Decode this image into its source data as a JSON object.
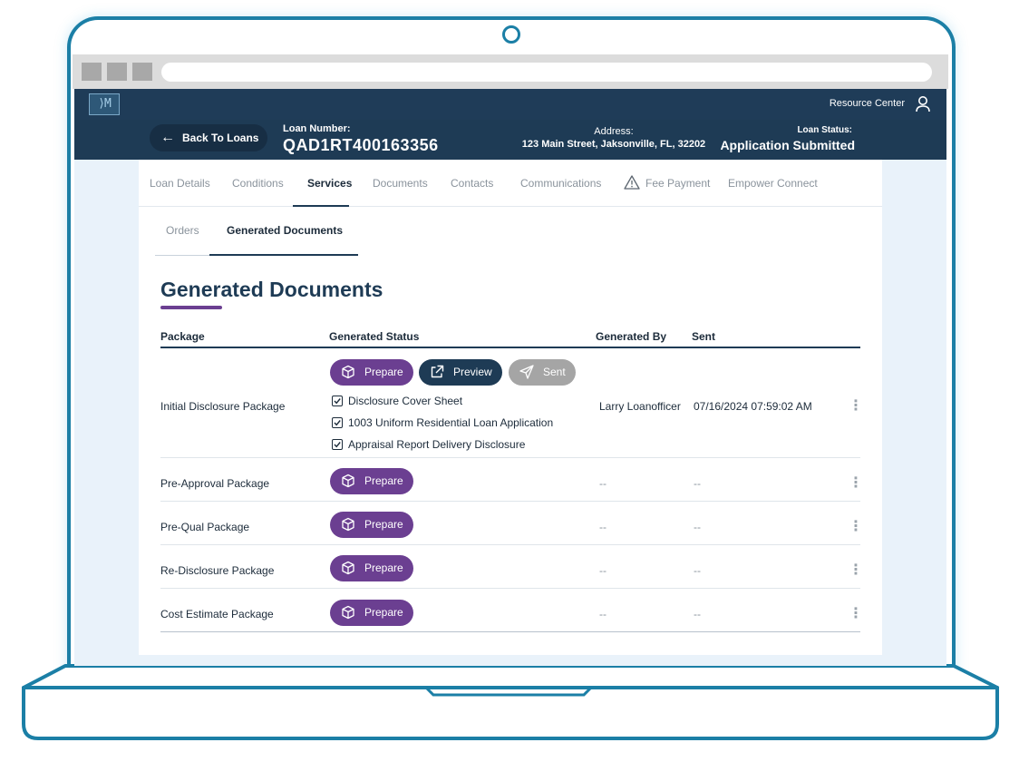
{
  "app": {
    "logo_text": "⟩M",
    "resource_center": "Resource Center"
  },
  "loan_header": {
    "back_label": "Back To Loans",
    "loan_number_label": "Loan Number:",
    "loan_number": "QAD1RT400163356",
    "address_label": "Address:",
    "address": "123 Main Street, Jaksonville, FL, 32202",
    "status_label": "Loan Status:",
    "status": "Application Submitted"
  },
  "tabs": [
    {
      "label": "Loan Details",
      "active": false
    },
    {
      "label": "Conditions",
      "active": false
    },
    {
      "label": "Services",
      "active": true
    },
    {
      "label": "Documents",
      "active": false
    },
    {
      "label": "Contacts",
      "active": false
    },
    {
      "label": "Communications",
      "active": false
    },
    {
      "label": "Fee Payment",
      "active": false,
      "icon": "warning-icon"
    },
    {
      "label": "Empower Connect",
      "active": false
    }
  ],
  "subtabs": [
    {
      "label": "Orders",
      "active": false
    },
    {
      "label": "Generated Documents",
      "active": true
    }
  ],
  "section": {
    "title": "Generated Documents"
  },
  "table": {
    "headers": [
      "Package",
      "Generated Status",
      "Generated By",
      "Sent"
    ],
    "actions": {
      "prepare": "Prepare",
      "preview": "Preview",
      "sent": "Sent"
    },
    "rows": [
      {
        "package": "Initial Disclosure Package",
        "documents": [
          "Disclosure Cover Sheet",
          "1003 Uniform Residential Loan Application",
          "Appraisal Report Delivery Disclosure"
        ],
        "generated_by": "Larry Loanofficer",
        "sent": "07/16/2024 07:59:02 AM"
      },
      {
        "package": "Pre-Approval Package",
        "generated_by": "--",
        "sent": "--"
      },
      {
        "package": "Pre-Qual Package",
        "generated_by": "--",
        "sent": "--"
      },
      {
        "package": "Re-Disclosure Package",
        "generated_by": "--",
        "sent": "--"
      },
      {
        "package": "Cost Estimate Package",
        "generated_by": "--",
        "sent": "--"
      }
    ]
  },
  "colors": {
    "frame": "#1b7fa6",
    "navy": "#1e3b55",
    "purple": "#6b3f91",
    "gray_button": "#a5a5a5",
    "background": "#e9f2fa"
  }
}
